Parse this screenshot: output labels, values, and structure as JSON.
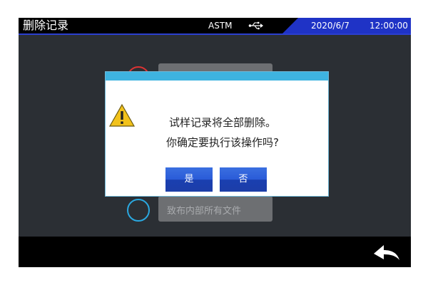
{
  "statusbar": {
    "title": "删除记录",
    "standard": "ASTM",
    "usb_icon": "usb-icon",
    "date": "2020/6/7",
    "time": "12:00:00",
    "accent_color": "#1f33c6"
  },
  "background_buttons": {
    "bottom_label": "致布内部所有文件"
  },
  "dialog": {
    "warning_icon": "warning-icon",
    "message_line1": "试样记录将全部删除。",
    "message_line2": "你确定要执行该操作吗?",
    "yes_label": "是",
    "no_label": "否",
    "title_color": "#3eb3e0"
  },
  "bottombar": {
    "back_icon": "back-arrow-icon"
  }
}
